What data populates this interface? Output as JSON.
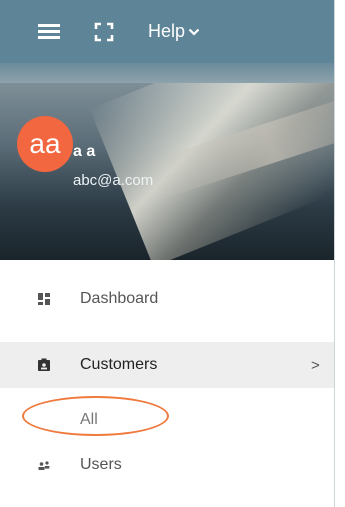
{
  "header": {
    "menu_icon": "hamburger-icon",
    "fullscreen_icon": "fullscreen-icon",
    "help_label": "Help",
    "help_icon": "chevron-down-icon"
  },
  "profile": {
    "avatar_initials": "aa",
    "name": "a a",
    "email": "abc@a.com"
  },
  "menu": {
    "items": [
      {
        "label": "Dashboard",
        "icon": "dashboard-icon"
      },
      {
        "label": "Customers",
        "icon": "customers-icon",
        "chevron": ">"
      },
      {
        "label": "All"
      },
      {
        "label": "Users",
        "icon": "users-icon"
      }
    ]
  },
  "colors": {
    "topbar": "#5d8497",
    "avatar": "#f26640",
    "highlight_ring": "#ef7a3e",
    "active_row": "#eeeeee"
  }
}
